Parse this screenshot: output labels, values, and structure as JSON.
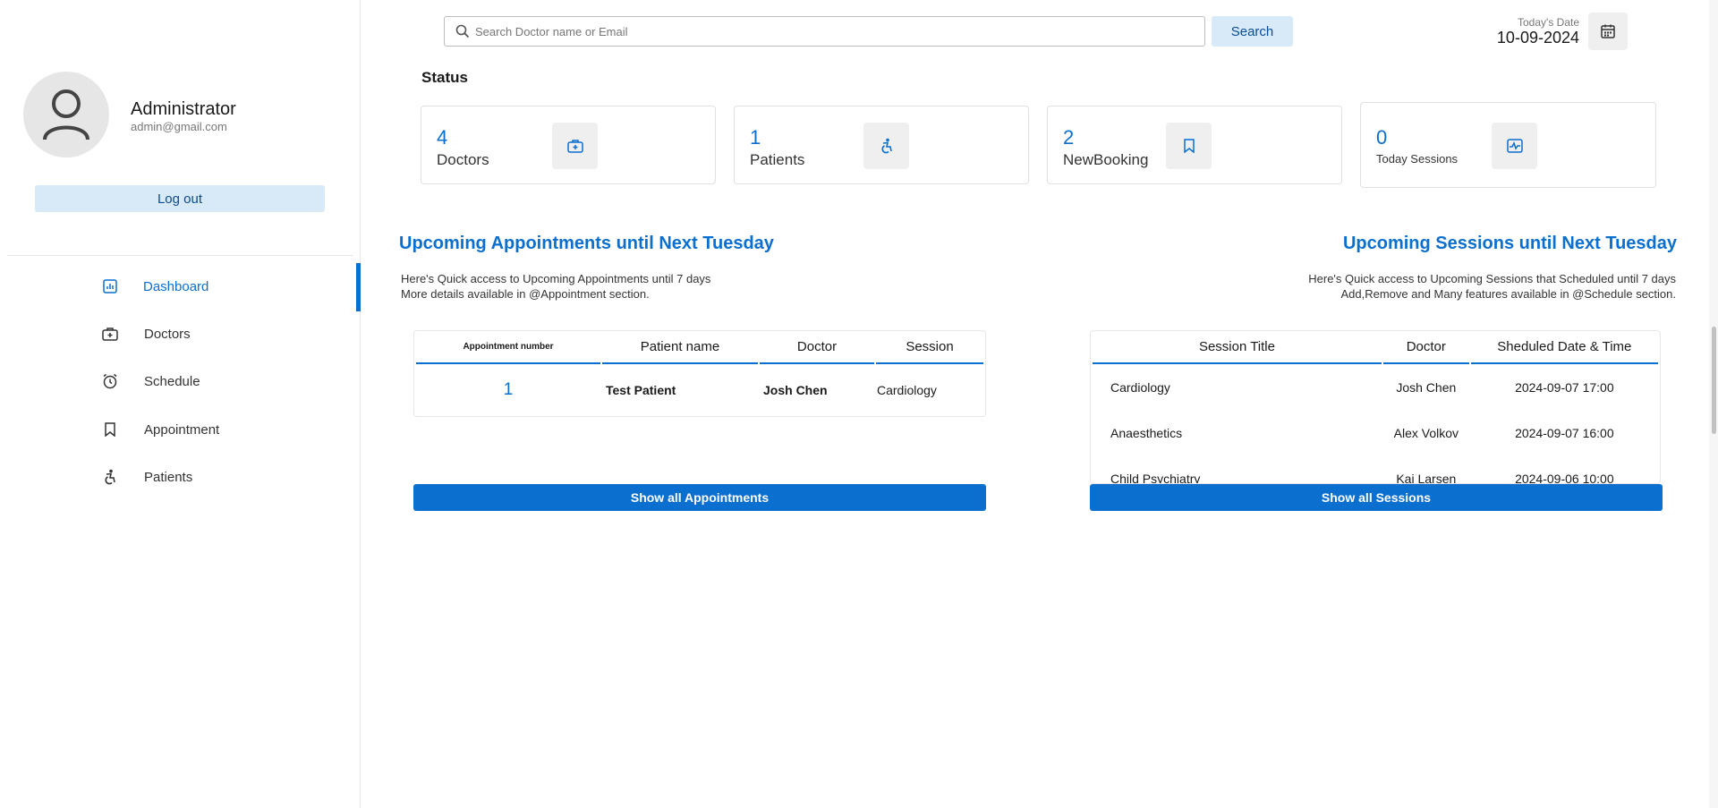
{
  "profile": {
    "name": "Administrator",
    "email": "admin@gmail.com",
    "logout_label": "Log out"
  },
  "sidebar": {
    "items": [
      {
        "label": "Dashboard",
        "icon": "dashboard-icon",
        "active": true
      },
      {
        "label": "Doctors",
        "icon": "medical-kit-icon",
        "active": false
      },
      {
        "label": "Schedule",
        "icon": "alarm-clock-icon",
        "active": false
      },
      {
        "label": "Appointment",
        "icon": "bookmark-icon",
        "active": false
      },
      {
        "label": "Patients",
        "icon": "accessibility-icon",
        "active": false
      }
    ]
  },
  "search": {
    "placeholder": "Search Doctor name or Email",
    "value": "",
    "button_label": "Search"
  },
  "date": {
    "label": "Today's Date",
    "value": "10-09-2024"
  },
  "status": {
    "title": "Status",
    "cards": [
      {
        "count": "4",
        "label": "Doctors",
        "icon": "medical-kit-icon"
      },
      {
        "count": "1",
        "label": "Patients",
        "icon": "accessibility-icon"
      },
      {
        "count": "2",
        "label": "NewBooking",
        "icon": "bookmark-icon"
      },
      {
        "count": "0",
        "label": "Today Sessions",
        "icon": "heart-monitor-icon"
      }
    ]
  },
  "appointments": {
    "title": "Upcoming Appointments until Next Tuesday",
    "desc_line1": "Here's Quick access to Upcoming Appointments until 7 days",
    "desc_line2": "More details available in @Appointment section.",
    "columns": [
      "Appointment number",
      "Patient name",
      "Doctor",
      "Session"
    ],
    "rows": [
      {
        "number": "1",
        "patient": "Test Patient",
        "doctor": "Josh Chen",
        "session": "Cardiology"
      }
    ],
    "button_label": "Show all Appointments"
  },
  "sessions": {
    "title": "Upcoming Sessions until Next Tuesday",
    "desc_line1": "Here's Quick access to Upcoming Sessions that Scheduled until 7 days",
    "desc_line2": "Add,Remove and Many features available in @Schedule section.",
    "columns": [
      "Session Title",
      "Doctor",
      "Sheduled Date & Time"
    ],
    "rows": [
      {
        "title": "Cardiology",
        "doctor": "Josh Chen",
        "datetime": "2024-09-07 17:00"
      },
      {
        "title": "Anaesthetics",
        "doctor": "Alex Volkov",
        "datetime": "2024-09-07 16:00"
      },
      {
        "title": "Child Psychiatry",
        "doctor": "Kai Larsen",
        "datetime": "2024-09-06 10:00"
      }
    ],
    "button_label": "Show all Sessions"
  },
  "colors": {
    "accent": "#0b6fcf",
    "light_accent": "#d8e9f8"
  }
}
